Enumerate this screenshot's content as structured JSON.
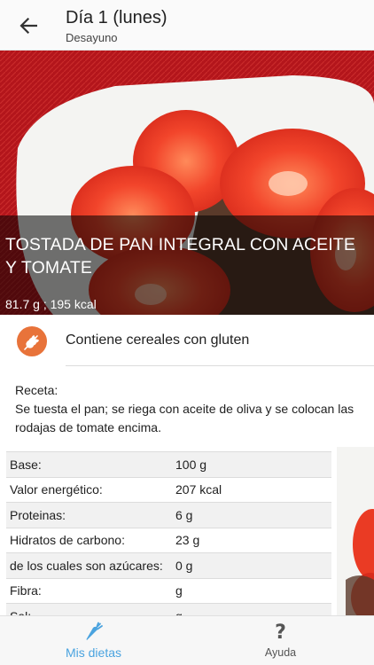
{
  "header": {
    "title": "Día 1 (lunes)",
    "subtitle": "Desayuno"
  },
  "dish": {
    "name": "TOSTADA DE PAN INTEGRAL CON ACEITE Y TOMATE",
    "weight": "81.7 g ; 195 kcal"
  },
  "allergen": {
    "icon": "wheat-icon",
    "text": "Contiene cereales con gluten",
    "color": "#e8733a"
  },
  "recipe": {
    "label": "Receta:",
    "text": "Se tuesta el pan; se riega con aceite de oliva y se colocan las rodajas de tomate encima."
  },
  "nutrition": {
    "rows": [
      {
        "label": "Base:",
        "value": "100 g"
      },
      {
        "label": "Valor energético:",
        "value": "207 kcal"
      },
      {
        "label": "Proteinas:",
        "value": "6 g"
      },
      {
        "label": "Hidratos de carbono:",
        "value": "23 g"
      },
      {
        "label": "de los cuales son azúcares:",
        "value": "0 g"
      },
      {
        "label": "Fibra:",
        "value": "g"
      },
      {
        "label": "Sal:",
        "value": "g"
      }
    ]
  },
  "bottom_nav": {
    "items": [
      {
        "label": "Mis dietas",
        "icon": "carrot-icon",
        "active": true
      },
      {
        "label": "Ayuda",
        "icon": "help-icon",
        "active": false
      }
    ],
    "active_color": "#4aa3df"
  }
}
